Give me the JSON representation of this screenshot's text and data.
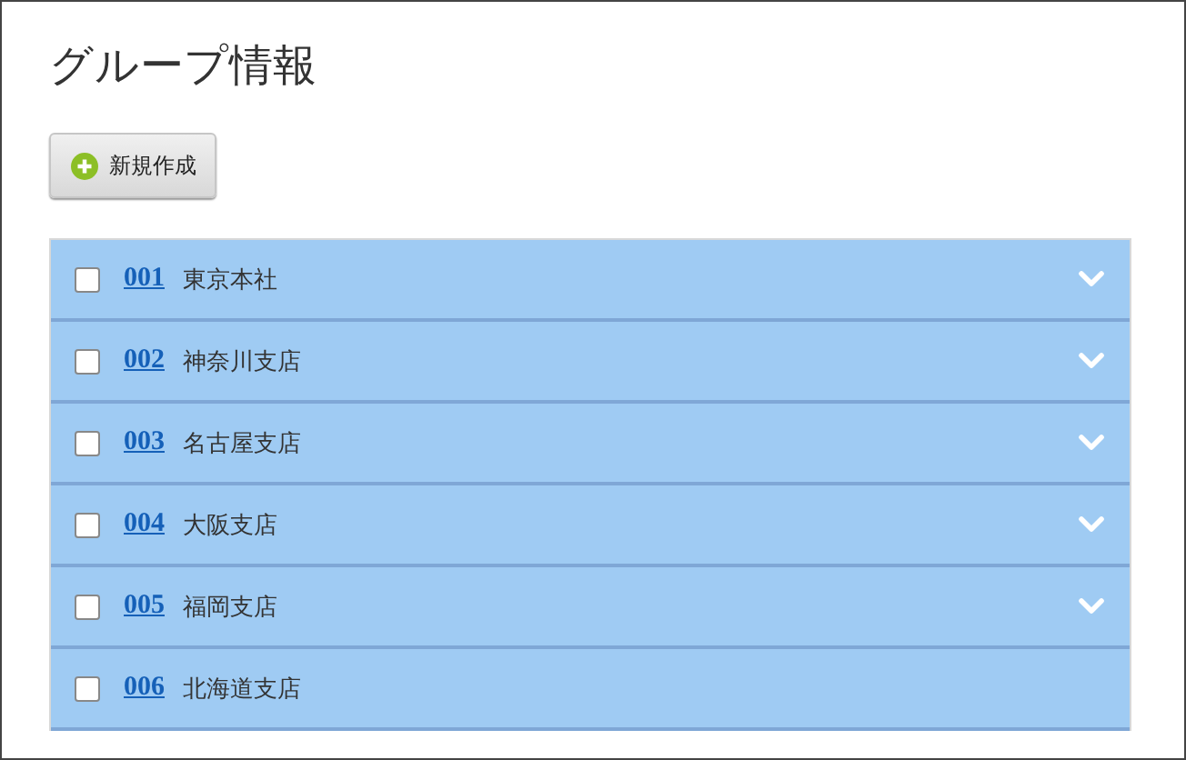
{
  "page": {
    "title": "グループ情報"
  },
  "new_button": {
    "label": "新規作成"
  },
  "groups": [
    {
      "code": "001",
      "name": "東京本社",
      "checked": false,
      "expandable": true
    },
    {
      "code": "002",
      "name": "神奈川支店",
      "checked": false,
      "expandable": true
    },
    {
      "code": "003",
      "name": "名古屋支店",
      "checked": false,
      "expandable": true
    },
    {
      "code": "004",
      "name": "大阪支店",
      "checked": false,
      "expandable": true
    },
    {
      "code": "005",
      "name": "福岡支店",
      "checked": false,
      "expandable": true
    },
    {
      "code": "006",
      "name": "北海道支店",
      "checked": false,
      "expandable": false
    }
  ]
}
